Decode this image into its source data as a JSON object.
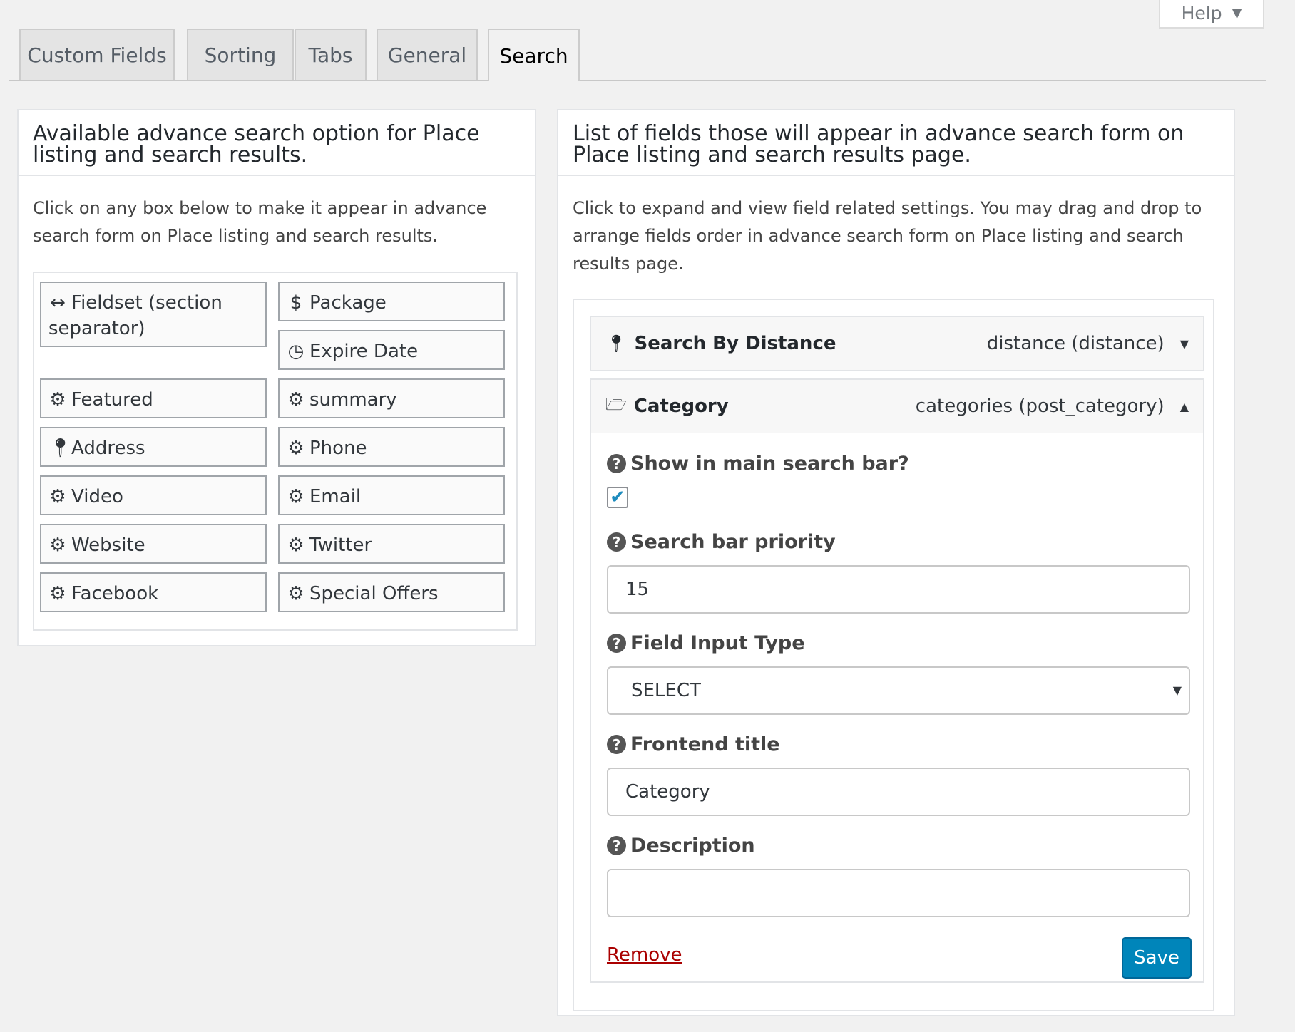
{
  "help": {
    "label": "Help"
  },
  "tabs": [
    {
      "label": "Custom Fields"
    },
    {
      "label": "Sorting"
    },
    {
      "label": "Tabs"
    },
    {
      "label": "General"
    },
    {
      "label": "Search"
    }
  ],
  "left_panel": {
    "title": "Available advance search option for Place listing and search results.",
    "description": "Click on any box below to make it appear in advance search form on Place listing and search results.",
    "options": [
      {
        "label": "Fieldset (section separator)",
        "icon": "arrows-horizontal-icon"
      },
      {
        "label": "Package",
        "icon": "dollar-icon"
      },
      {
        "label": "Expire Date",
        "icon": "clock-icon"
      },
      {
        "label": "Featured",
        "icon": "gear-icon"
      },
      {
        "label": "summary",
        "icon": "gear-icon"
      },
      {
        "label": "Address",
        "icon": "map-marker-icon"
      },
      {
        "label": "Phone",
        "icon": "gear-icon"
      },
      {
        "label": "Video",
        "icon": "gear-icon"
      },
      {
        "label": "Email",
        "icon": "gear-icon"
      },
      {
        "label": "Website",
        "icon": "gear-icon"
      },
      {
        "label": "Twitter",
        "icon": "gear-icon"
      },
      {
        "label": "Facebook",
        "icon": "gear-icon"
      },
      {
        "label": "Special Offers",
        "icon": "gear-icon"
      }
    ]
  },
  "right_panel": {
    "title": "List of fields those will appear in advance search form on Place listing and search results page.",
    "description": "Click to expand and view field related settings. You may drag and drop to arrange fields order in advance search form on Place listing and search results page.",
    "fields": [
      {
        "title": "Search By Distance",
        "meta": "distance (distance)",
        "icon": "map-marker-icon"
      },
      {
        "title": "Category",
        "meta": "categories (post_category)",
        "icon": "folder-open-icon"
      }
    ],
    "settings": {
      "show_in_main_label": "Show in main search bar?",
      "show_in_main_checked": true,
      "priority_label": "Search bar priority",
      "priority_value": "15",
      "input_type_label": "Field Input Type",
      "input_type_value": "SELECT",
      "frontend_title_label": "Frontend title",
      "frontend_title_value": "Category",
      "description_label": "Description",
      "description_value": "",
      "remove_label": "Remove",
      "save_label": "Save"
    }
  },
  "colors": {
    "primary_button": "#0085ba",
    "remove_link": "#aa0000",
    "checkbox_mark": "#1e8cbe"
  }
}
